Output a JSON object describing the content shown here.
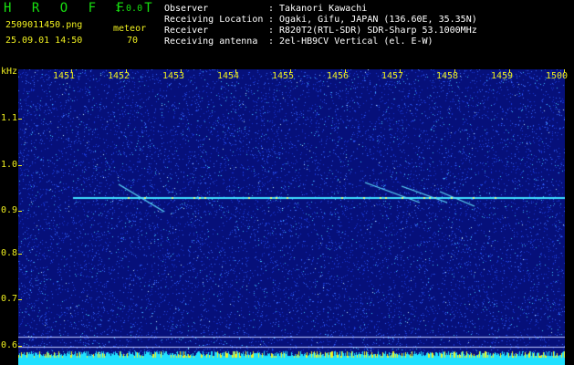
{
  "header": {
    "app_name": "H R O F F T",
    "version": "1.0.0",
    "filename": "2509011450.png",
    "datetime": "25.09.01 14:50",
    "meteor_label": "meteor",
    "meteor_count": "70",
    "info": [
      {
        "key": "Observer",
        "value": "Takanori Kawachi"
      },
      {
        "key": "Receiving Location",
        "value": "Ogaki, Gifu, JAPAN (136.60E, 35.35N)"
      },
      {
        "key": "Receiver",
        "value": "R820T2(RTL-SDR) SDR-Sharp 53.1000MHz"
      },
      {
        "key": "Receiving antenna",
        "value": "2el-HB9CV Vertical (el. E-W)"
      }
    ]
  },
  "axes": {
    "y_unit": "kHz",
    "y_ticks": [
      "1.1",
      "1.0",
      "0.9",
      "0.8",
      "0.7",
      "0.6"
    ],
    "x_ticks": [
      "1451",
      "1452",
      "1453",
      "1454",
      "1455",
      "1456",
      "1457",
      "1458",
      "1459",
      "1500"
    ]
  },
  "colors": {
    "background": "#000000",
    "label_yellow": "#f0f020",
    "logo_green": "#18e010",
    "noise_blue": "#0a1aa0",
    "carrier_cyan": "#40e0ff"
  }
}
